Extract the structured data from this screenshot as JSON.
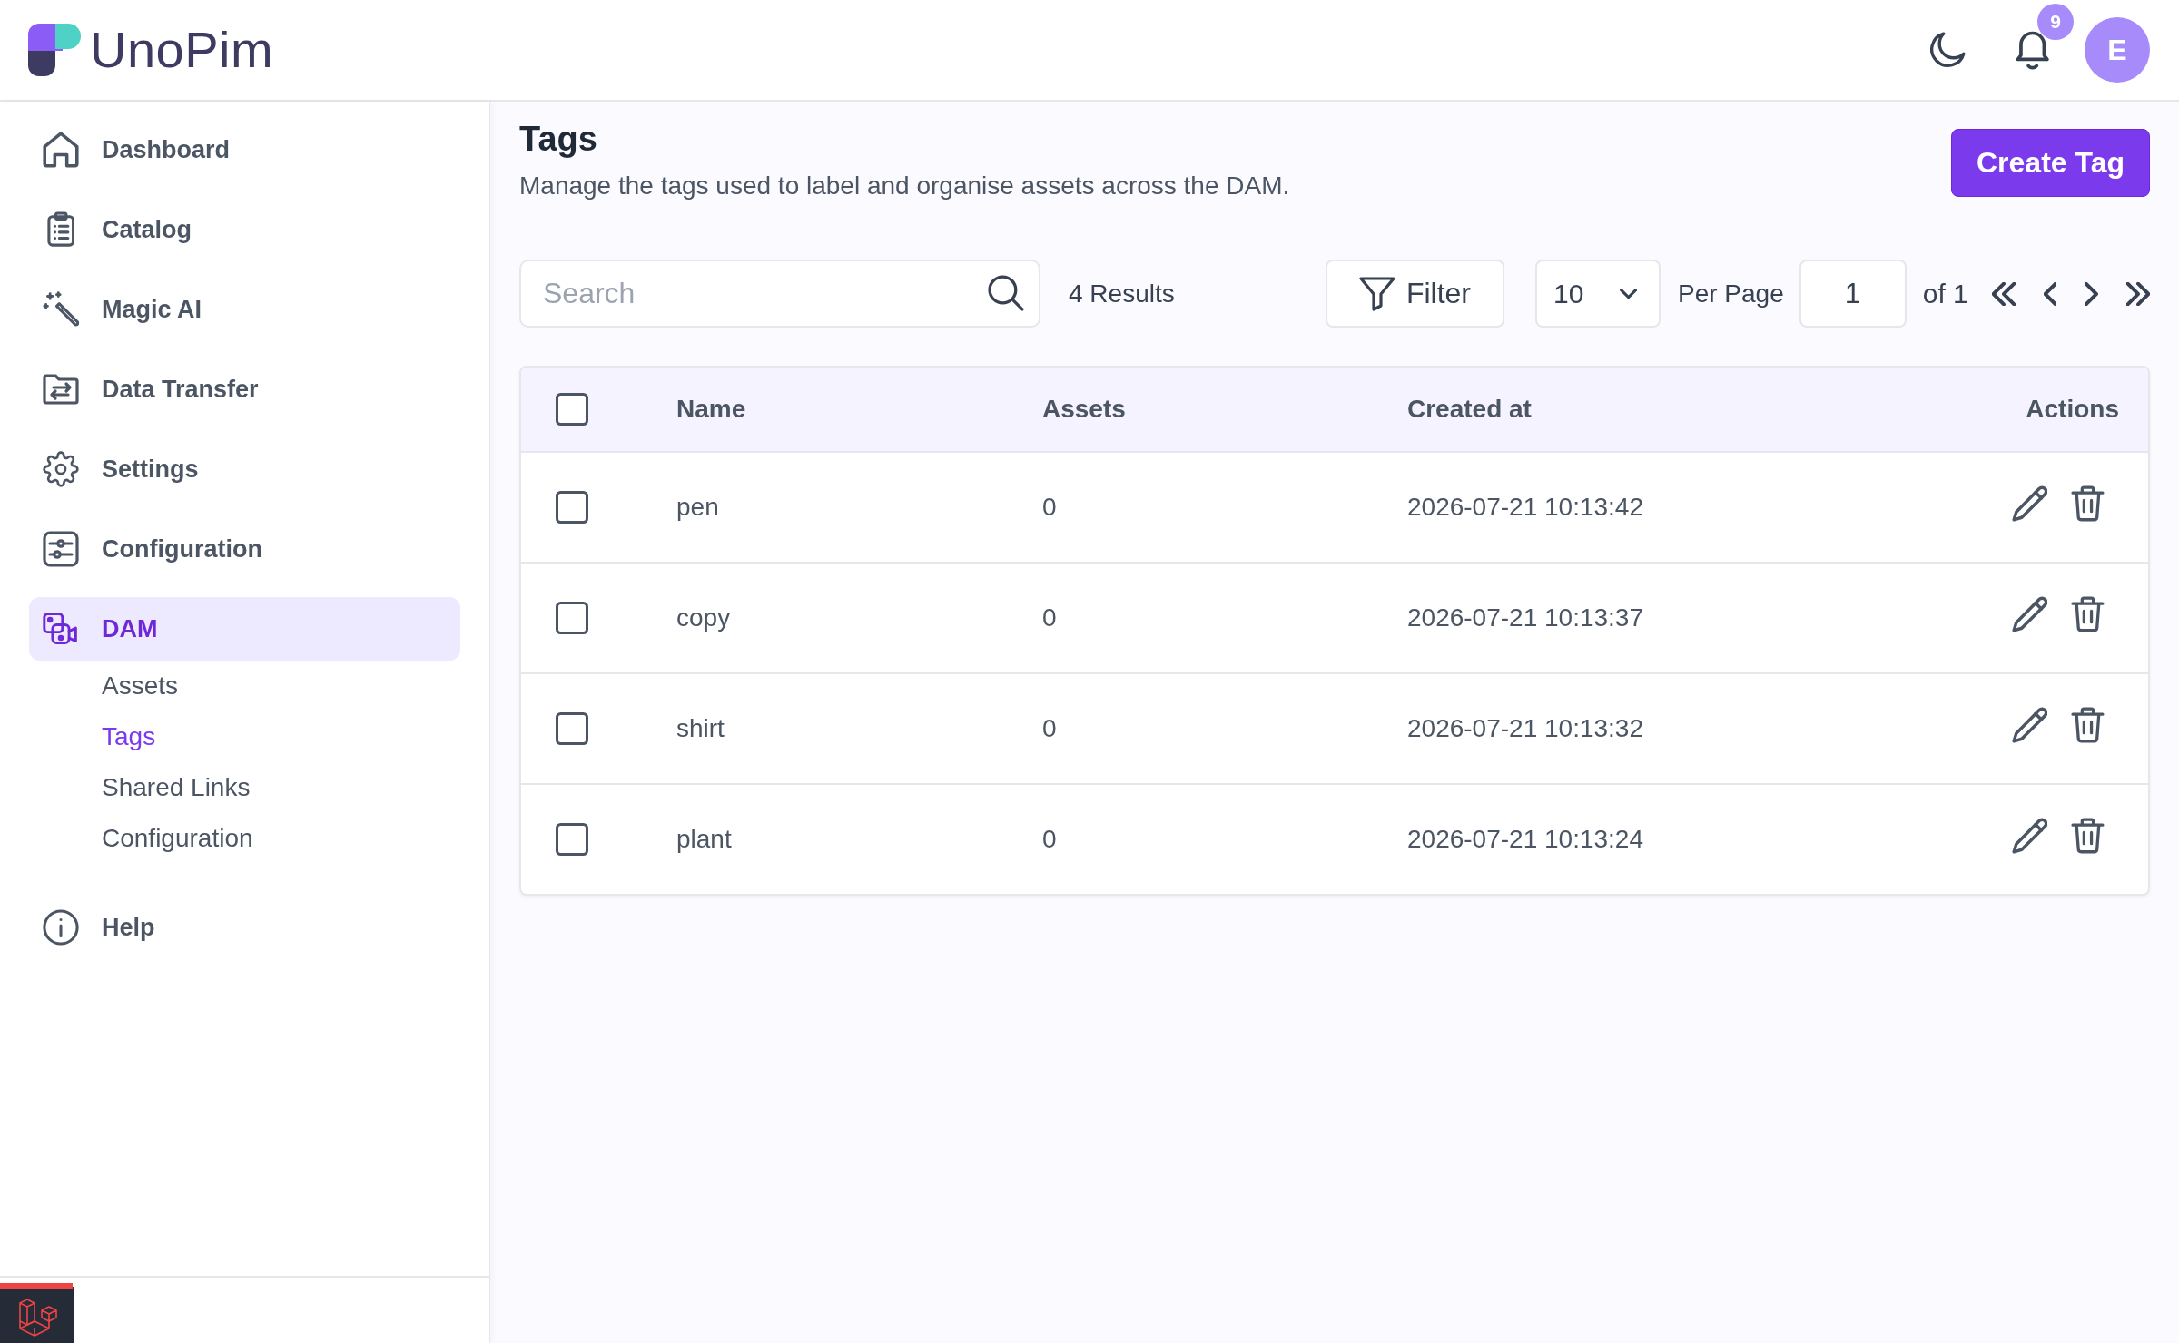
{
  "header": {
    "logo_text": "UnoPim",
    "notification_count": "9",
    "avatar_initial": "E"
  },
  "sidebar": {
    "items": [
      {
        "label": "Dashboard",
        "selected": false
      },
      {
        "label": "Catalog",
        "selected": false
      },
      {
        "label": "Magic AI",
        "selected": false
      },
      {
        "label": "Data Transfer",
        "selected": false
      },
      {
        "label": "Settings",
        "selected": false
      },
      {
        "label": "Configuration",
        "selected": false
      },
      {
        "label": "DAM",
        "selected": true,
        "children": [
          {
            "label": "Assets",
            "selected": false
          },
          {
            "label": "Tags",
            "selected": true
          },
          {
            "label": "Shared Links",
            "selected": false
          },
          {
            "label": "Configuration",
            "selected": false
          }
        ]
      },
      {
        "label": "Help",
        "selected": false
      }
    ]
  },
  "page": {
    "title": "Tags",
    "description": "Manage the tags used to label and organise assets across the DAM.",
    "create_button": "Create Tag"
  },
  "toolbar": {
    "search": {
      "placeholder": "Search"
    },
    "results": "4 Results",
    "filter_button": "Filter",
    "per_page": {
      "value": "10",
      "label": "Per Page"
    },
    "page": {
      "value": "1",
      "total": "of 1"
    }
  },
  "table": {
    "select_all": {
      "checked": false
    },
    "columns": [
      "Name",
      "Assets",
      "Created at",
      "Actions"
    ],
    "rows": [
      {
        "checked": false,
        "name": "pen",
        "assets": "0",
        "created_at": "2026-07-21 10:13:42"
      },
      {
        "checked": false,
        "name": "copy",
        "assets": "0",
        "created_at": "2026-07-21 10:13:37"
      },
      {
        "checked": false,
        "name": "shirt",
        "assets": "0",
        "created_at": "2026-07-21 10:13:32"
      },
      {
        "checked": false,
        "name": "plant",
        "assets": "0",
        "created_at": "2026-07-21 10:13:24"
      }
    ]
  }
}
